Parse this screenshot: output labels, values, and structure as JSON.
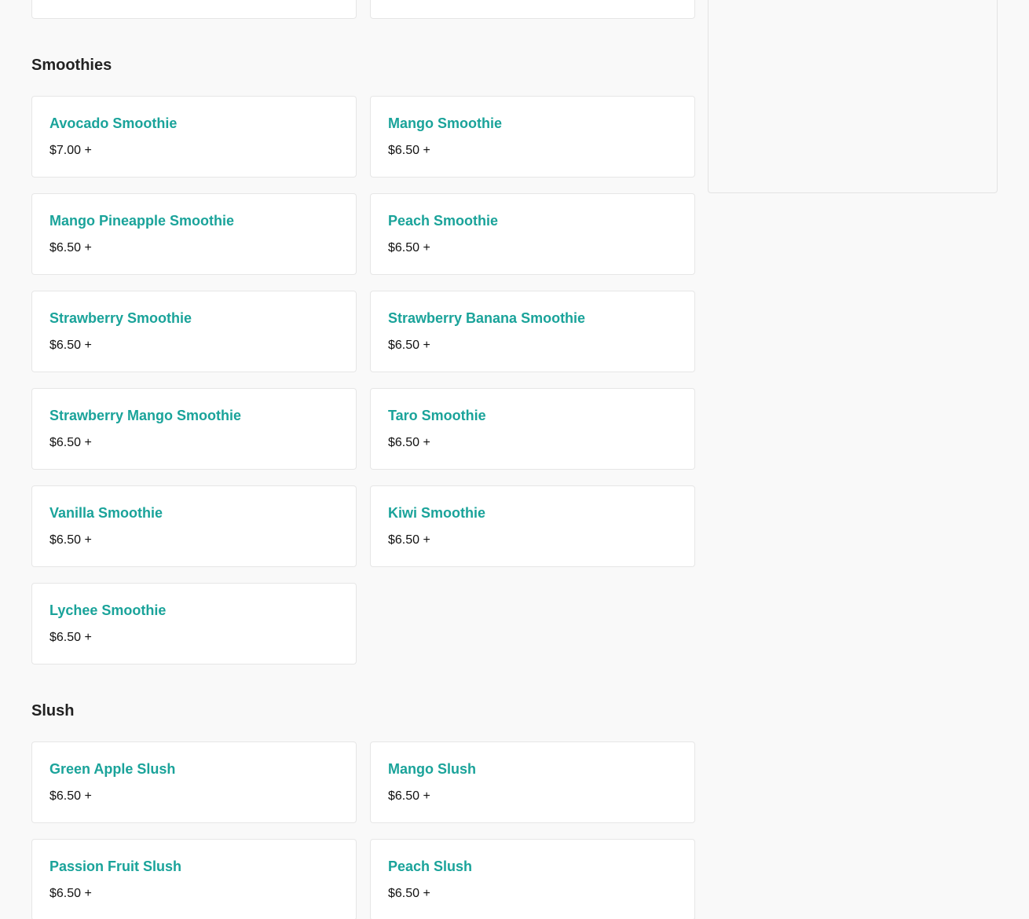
{
  "sections": {
    "smoothies": {
      "title": "Smoothies",
      "items": [
        {
          "name": "Avocado Smoothie",
          "price": "$7.00 +"
        },
        {
          "name": "Mango Smoothie",
          "price": "$6.50 +"
        },
        {
          "name": "Mango Pineapple Smoothie",
          "price": "$6.50 +"
        },
        {
          "name": "Peach Smoothie",
          "price": "$6.50 +"
        },
        {
          "name": "Strawberry Smoothie",
          "price": "$6.50 +"
        },
        {
          "name": "Strawberry Banana Smoothie",
          "price": "$6.50 +"
        },
        {
          "name": "Strawberry Mango Smoothie",
          "price": "$6.50 +"
        },
        {
          "name": "Taro Smoothie",
          "price": "$6.50 +"
        },
        {
          "name": "Vanilla Smoothie",
          "price": "$6.50 +"
        },
        {
          "name": "Kiwi Smoothie",
          "price": "$6.50 +"
        },
        {
          "name": "Lychee Smoothie",
          "price": "$6.50 +"
        }
      ]
    },
    "slush": {
      "title": "Slush",
      "items": [
        {
          "name": "Green Apple Slush",
          "price": "$6.50 +"
        },
        {
          "name": "Mango Slush",
          "price": "$6.50 +"
        },
        {
          "name": "Passion Fruit Slush",
          "price": "$6.50 +"
        },
        {
          "name": "Peach Slush",
          "price": "$6.50 +"
        }
      ]
    }
  },
  "colors": {
    "background": "#f9f9f9",
    "item_name": "#1aa39a",
    "price": "#111111",
    "card_border": "#e6e6e6"
  }
}
